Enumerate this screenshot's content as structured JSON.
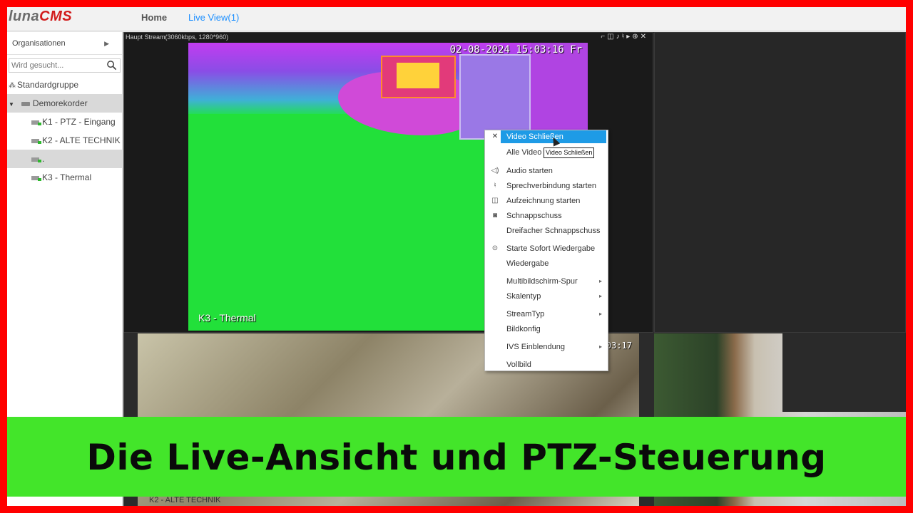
{
  "app": {
    "logo_main": "luna",
    "logo_accent": "CMS"
  },
  "nav": {
    "home": "Home",
    "live_view": "Live View(1)"
  },
  "sidebar": {
    "org_label": "Organisationen",
    "search_placeholder": "Wird gesucht...",
    "group": "Standardgruppe",
    "recorder": "Demorekorder",
    "items": [
      {
        "label": "K1  - PTZ - Eingang"
      },
      {
        "label": "K2 - ALTE TECHNIK"
      },
      {
        "label": "."
      },
      {
        "label": "K3 - Thermal"
      }
    ]
  },
  "main_pane": {
    "title": "Haupt Stream(3060kbps, 1280*960)",
    "osd_time": "02-08-2024 15:03:16 Fr",
    "osd_name": "K3 - Thermal"
  },
  "bottom_pane": {
    "osd_time": "03:17",
    "osd_name": "K2 - ALTE TECHNIK"
  },
  "context_menu": {
    "items": [
      {
        "label": "Video Schließen",
        "icon": "close-icon"
      },
      {
        "label": "Alle Video"
      },
      {
        "label": "Audio starten",
        "icon": "speaker-icon"
      },
      {
        "label": "Sprechverbindung starten",
        "icon": "microphone-icon"
      },
      {
        "label": "Aufzeichnung starten",
        "icon": "record-icon"
      },
      {
        "label": "Schnappschuss",
        "icon": "camera-icon"
      },
      {
        "label": "Dreifacher Schnappschuss"
      },
      {
        "label": "Starte Sofort Wiedergabe",
        "icon": "play-icon"
      },
      {
        "label": "Wiedergabe"
      },
      {
        "label": "Multibildschirm-Spur",
        "has_submenu": true
      },
      {
        "label": "Skalentyp",
        "has_submenu": true
      },
      {
        "label": "StreamTyp",
        "has_submenu": true
      },
      {
        "label": "Bildkonfig"
      },
      {
        "label": "IVS Einblendung",
        "has_submenu": true
      },
      {
        "label": "Vollbild"
      }
    ],
    "tooltip": "Video Schließen"
  },
  "caption": {
    "text": "Die Live-Ansicht und PTZ-Steuerung"
  },
  "colors": {
    "frame_border": "#ff0000",
    "caption_bg": "#43e52a",
    "highlight": "#1e9be6",
    "live_tab": "#1e90ff",
    "logo_accent": "#d11a1a"
  }
}
